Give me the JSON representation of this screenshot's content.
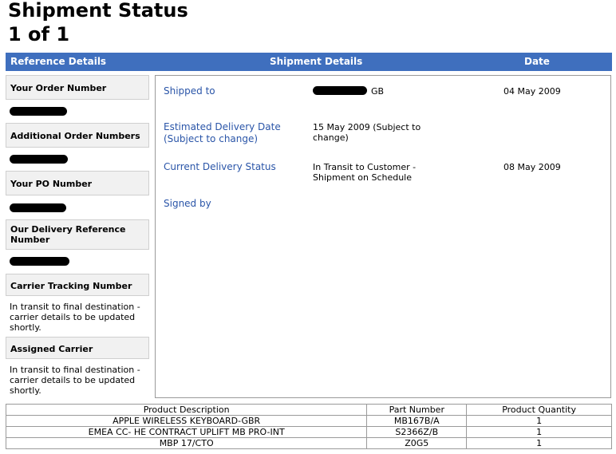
{
  "page": {
    "title": "Shipment Status",
    "subtitle": "1 of 1"
  },
  "header": {
    "reference_details": "Reference Details",
    "shipment_details": "Shipment Details",
    "date": "Date"
  },
  "reference": {
    "order_number_label": "Your Order Number",
    "additional_order_numbers_label": "Additional Order Numbers",
    "po_number_label": "Your PO Number",
    "delivery_reference_label": "Our Delivery Reference Number",
    "carrier_tracking_label": "Carrier Tracking Number",
    "carrier_tracking_value": "In transit to final destination - carrier details to be updated shortly.",
    "assigned_carrier_label": "Assigned Carrier",
    "assigned_carrier_value": "In transit to final destination - carrier details to be updated shortly."
  },
  "shipment": {
    "shipped_to_label": "Shipped to",
    "shipped_to_value": "GB",
    "shipped_to_date": "04 May 2009",
    "estimated_delivery_label": "Estimated Delivery Date (Subject to change)",
    "estimated_delivery_value": "15 May 2009 (Subject to change)",
    "delivery_status_label": "Current Delivery Status",
    "delivery_status_value": "In Transit to Customer - Shipment on Schedule",
    "delivery_status_date": "08 May 2009",
    "signed_by_label": "Signed by"
  },
  "products": {
    "columns": [
      "Product Description",
      "Part Number",
      "Product Quantity"
    ],
    "rows": [
      [
        "APPLE WIRELESS KEYBOARD-GBR",
        "MB167B/A",
        "1"
      ],
      [
        "EMEA CC- HE CONTRACT UPLIFT MB PRO-INT",
        "S2366Z/B",
        "1"
      ],
      [
        "MBP 17/CTO",
        "Z0G5",
        "1"
      ]
    ]
  },
  "colors": {
    "header_bar": "#3f6fbe",
    "field_label": "#2a55a8",
    "ref_box_bg": "#f1f1f1"
  }
}
